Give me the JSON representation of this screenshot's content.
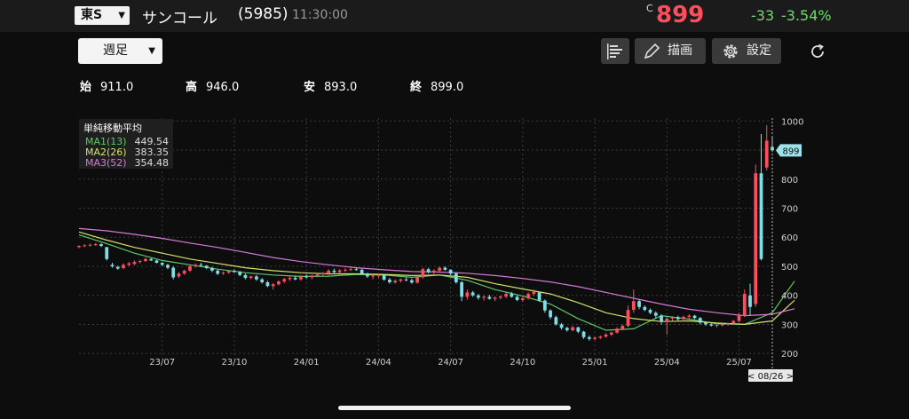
{
  "header": {
    "market": "東S",
    "name": "サンコール",
    "code": "(5985)",
    "time": "11:30:00",
    "price_flag": "C",
    "price": "899",
    "change": "-33",
    "change_pct": "-3.54%"
  },
  "toolbar": {
    "period": "週足",
    "draw_label": "描画",
    "settings_label": "設定"
  },
  "ohlc": {
    "open_label": "始",
    "open": "911.0",
    "high_label": "高",
    "high": "946.0",
    "low_label": "安",
    "low": "893.0",
    "close_label": "終",
    "close": "899.0"
  },
  "legend": {
    "title": "単純移動平均",
    "ma1_name": "MA1(13)",
    "ma1_value": "449.54",
    "ma2_name": "MA2(26)",
    "ma2_value": "383.35",
    "ma3_name": "MA3(52)",
    "ma3_value": "354.48"
  },
  "colors": {
    "up": "#ff4d5e",
    "down": "#7fdde6",
    "ma1": "#5ec86a",
    "ma2": "#d7e06e",
    "ma3": "#d57ad5",
    "price_tag": "#9be3ec"
  },
  "chart_data": {
    "type": "candlestick",
    "ylim": [
      170,
      1010
    ],
    "yticks": [
      200,
      300,
      400,
      500,
      600,
      700,
      800,
      900,
      1000
    ],
    "xtick_labels": [
      "23/07",
      "23/10",
      "24/01",
      "24/04",
      "24/07",
      "24/10",
      "25/01",
      "25/04",
      "25/07"
    ],
    "xtick_index": [
      15,
      28,
      41,
      54,
      67,
      80,
      93,
      106,
      119
    ],
    "current_price": "899",
    "current_date": "< 08/26 >",
    "candles": [
      [
        566,
        572,
        562,
        570
      ],
      [
        570,
        576,
        566,
        572
      ],
      [
        572,
        578,
        568,
        574
      ],
      [
        574,
        580,
        570,
        576
      ],
      [
        576,
        580,
        566,
        570
      ],
      [
        566,
        566,
        520,
        525
      ],
      [
        505,
        512,
        495,
        500
      ],
      [
        498,
        502,
        488,
        492
      ],
      [
        494,
        510,
        490,
        505
      ],
      [
        505,
        515,
        500,
        510
      ],
      [
        508,
        520,
        504,
        515
      ],
      [
        515,
        522,
        510,
        518
      ],
      [
        518,
        530,
        515,
        525
      ],
      [
        525,
        528,
        518,
        520
      ],
      [
        520,
        522,
        510,
        512
      ],
      [
        512,
        514,
        500,
        505
      ],
      [
        505,
        508,
        490,
        495
      ],
      [
        495,
        500,
        455,
        462
      ],
      [
        465,
        480,
        460,
        475
      ],
      [
        475,
        488,
        470,
        485
      ],
      [
        485,
        505,
        480,
        500
      ],
      [
        500,
        510,
        495,
        505
      ],
      [
        505,
        512,
        498,
        502
      ],
      [
        502,
        504,
        490,
        494
      ],
      [
        494,
        498,
        480,
        485
      ],
      [
        485,
        488,
        470,
        474
      ],
      [
        475,
        482,
        470,
        478
      ],
      [
        478,
        488,
        474,
        484
      ],
      [
        484,
        490,
        478,
        480
      ],
      [
        480,
        484,
        466,
        470
      ],
      [
        470,
        475,
        455,
        460
      ],
      [
        460,
        468,
        455,
        465
      ],
      [
        465,
        470,
        450,
        455
      ],
      [
        455,
        460,
        440,
        445
      ],
      [
        445,
        450,
        428,
        432
      ],
      [
        432,
        442,
        420,
        438
      ],
      [
        438,
        452,
        434,
        448
      ],
      [
        448,
        460,
        442,
        456
      ],
      [
        456,
        465,
        450,
        460
      ],
      [
        460,
        468,
        452,
        455
      ],
      [
        455,
        470,
        450,
        465
      ],
      [
        465,
        472,
        458,
        462
      ],
      [
        462,
        470,
        455,
        468
      ],
      [
        468,
        478,
        462,
        472
      ],
      [
        472,
        480,
        466,
        476
      ],
      [
        476,
        490,
        470,
        485
      ],
      [
        485,
        492,
        475,
        480
      ],
      [
        480,
        490,
        476,
        486
      ],
      [
        486,
        494,
        480,
        488
      ],
      [
        488,
        495,
        484,
        490
      ],
      [
        490,
        496,
        485,
        488
      ],
      [
        488,
        492,
        470,
        474
      ],
      [
        474,
        478,
        460,
        465
      ],
      [
        465,
        472,
        455,
        468
      ],
      [
        468,
        475,
        460,
        470
      ],
      [
        470,
        474,
        450,
        454
      ],
      [
        454,
        460,
        440,
        445
      ],
      [
        445,
        455,
        440,
        450
      ],
      [
        450,
        458,
        444,
        455
      ],
      [
        455,
        462,
        448,
        452
      ],
      [
        452,
        458,
        440,
        444
      ],
      [
        444,
        465,
        440,
        462
      ],
      [
        462,
        495,
        458,
        490
      ],
      [
        490,
        495,
        475,
        480
      ],
      [
        480,
        490,
        472,
        485
      ],
      [
        485,
        498,
        480,
        495
      ],
      [
        495,
        500,
        485,
        488
      ],
      [
        488,
        490,
        470,
        475
      ],
      [
        475,
        480,
        440,
        445
      ],
      [
        445,
        450,
        380,
        395
      ],
      [
        395,
        420,
        385,
        410
      ],
      [
        410,
        415,
        395,
        400
      ],
      [
        400,
        405,
        385,
        392
      ],
      [
        392,
        400,
        382,
        395
      ],
      [
        395,
        402,
        385,
        388
      ],
      [
        388,
        396,
        380,
        392
      ],
      [
        392,
        400,
        386,
        396
      ],
      [
        396,
        410,
        390,
        405
      ],
      [
        405,
        412,
        392,
        395
      ],
      [
        395,
        400,
        380,
        384
      ],
      [
        384,
        395,
        378,
        390
      ],
      [
        390,
        410,
        385,
        405
      ],
      [
        405,
        420,
        398,
        412
      ],
      [
        410,
        412,
        378,
        382
      ],
      [
        382,
        386,
        340,
        348
      ],
      [
        348,
        352,
        318,
        325
      ],
      [
        325,
        330,
        296,
        300
      ],
      [
        300,
        305,
        282,
        288
      ],
      [
        288,
        292,
        275,
        280
      ],
      [
        280,
        295,
        276,
        290
      ],
      [
        290,
        292,
        270,
        275
      ],
      [
        275,
        278,
        250,
        256
      ],
      [
        256,
        262,
        244,
        250
      ],
      [
        250,
        258,
        246,
        254
      ],
      [
        254,
        262,
        250,
        258
      ],
      [
        258,
        270,
        254,
        265
      ],
      [
        265,
        275,
        260,
        272
      ],
      [
        272,
        290,
        268,
        285
      ],
      [
        285,
        300,
        280,
        295
      ],
      [
        295,
        365,
        290,
        350
      ],
      [
        350,
        420,
        340,
        380
      ],
      [
        380,
        385,
        352,
        360
      ],
      [
        360,
        365,
        345,
        350
      ],
      [
        350,
        355,
        335,
        340
      ],
      [
        340,
        345,
        322,
        330
      ],
      [
        330,
        335,
        300,
        310
      ],
      [
        310,
        325,
        265,
        320
      ],
      [
        320,
        328,
        312,
        325
      ],
      [
        325,
        330,
        312,
        318
      ],
      [
        318,
        330,
        312,
        326
      ],
      [
        326,
        335,
        320,
        330
      ],
      [
        330,
        333,
        318,
        322
      ],
      [
        322,
        325,
        300,
        306
      ],
      [
        306,
        310,
        295,
        300
      ],
      [
        300,
        304,
        293,
        296
      ],
      [
        296,
        302,
        290,
        298
      ],
      [
        298,
        304,
        293,
        300
      ],
      [
        300,
        306,
        295,
        303
      ],
      [
        303,
        315,
        300,
        312
      ],
      [
        312,
        340,
        308,
        330
      ],
      [
        330,
        420,
        325,
        405
      ],
      [
        400,
        440,
        330,
        360
      ],
      [
        370,
        850,
        360,
        820
      ],
      [
        820,
        955,
        520,
        525
      ],
      [
        840,
        985,
        830,
        932
      ],
      [
        911,
        946,
        893,
        899
      ]
    ],
    "ma_series": [
      {
        "name": "MA1(13)",
        "color": "#5ec86a",
        "points": [
          [
            0,
            608
          ],
          [
            5,
            578
          ],
          [
            10,
            545
          ],
          [
            15,
            520
          ],
          [
            20,
            505
          ],
          [
            25,
            490
          ],
          [
            30,
            478
          ],
          [
            35,
            470
          ],
          [
            40,
            465
          ],
          [
            45,
            466
          ],
          [
            50,
            472
          ],
          [
            55,
            470
          ],
          [
            60,
            462
          ],
          [
            65,
            470
          ],
          [
            70,
            452
          ],
          [
            75,
            420
          ],
          [
            80,
            398
          ],
          [
            85,
            370
          ],
          [
            90,
            320
          ],
          [
            95,
            280
          ],
          [
            100,
            285
          ],
          [
            105,
            330
          ],
          [
            110,
            318
          ],
          [
            115,
            302
          ],
          [
            120,
            300
          ],
          [
            125,
            340
          ],
          [
            129,
            449
          ]
        ]
      },
      {
        "name": "MA2(26)",
        "color": "#d7e06e",
        "points": [
          [
            0,
            618
          ],
          [
            5,
            590
          ],
          [
            10,
            565
          ],
          [
            15,
            545
          ],
          [
            20,
            525
          ],
          [
            25,
            510
          ],
          [
            30,
            495
          ],
          [
            35,
            485
          ],
          [
            40,
            478
          ],
          [
            45,
            474
          ],
          [
            50,
            474
          ],
          [
            55,
            472
          ],
          [
            60,
            468
          ],
          [
            65,
            470
          ],
          [
            70,
            462
          ],
          [
            75,
            440
          ],
          [
            80,
            422
          ],
          [
            85,
            405
          ],
          [
            90,
            375
          ],
          [
            95,
            340
          ],
          [
            100,
            320
          ],
          [
            105,
            310
          ],
          [
            110,
            312
          ],
          [
            115,
            305
          ],
          [
            120,
            300
          ],
          [
            125,
            312
          ],
          [
            129,
            383
          ]
        ]
      },
      {
        "name": "MA3(52)",
        "color": "#d57ad5",
        "points": [
          [
            0,
            630
          ],
          [
            5,
            622
          ],
          [
            10,
            610
          ],
          [
            15,
            596
          ],
          [
            20,
            580
          ],
          [
            25,
            565
          ],
          [
            30,
            548
          ],
          [
            35,
            530
          ],
          [
            40,
            516
          ],
          [
            45,
            505
          ],
          [
            50,
            495
          ],
          [
            55,
            488
          ],
          [
            60,
            482
          ],
          [
            65,
            480
          ],
          [
            70,
            476
          ],
          [
            75,
            468
          ],
          [
            80,
            458
          ],
          [
            85,
            446
          ],
          [
            90,
            430
          ],
          [
            95,
            410
          ],
          [
            100,
            390
          ],
          [
            105,
            370
          ],
          [
            110,
            352
          ],
          [
            115,
            340
          ],
          [
            120,
            330
          ],
          [
            125,
            335
          ],
          [
            129,
            354
          ]
        ]
      }
    ]
  }
}
